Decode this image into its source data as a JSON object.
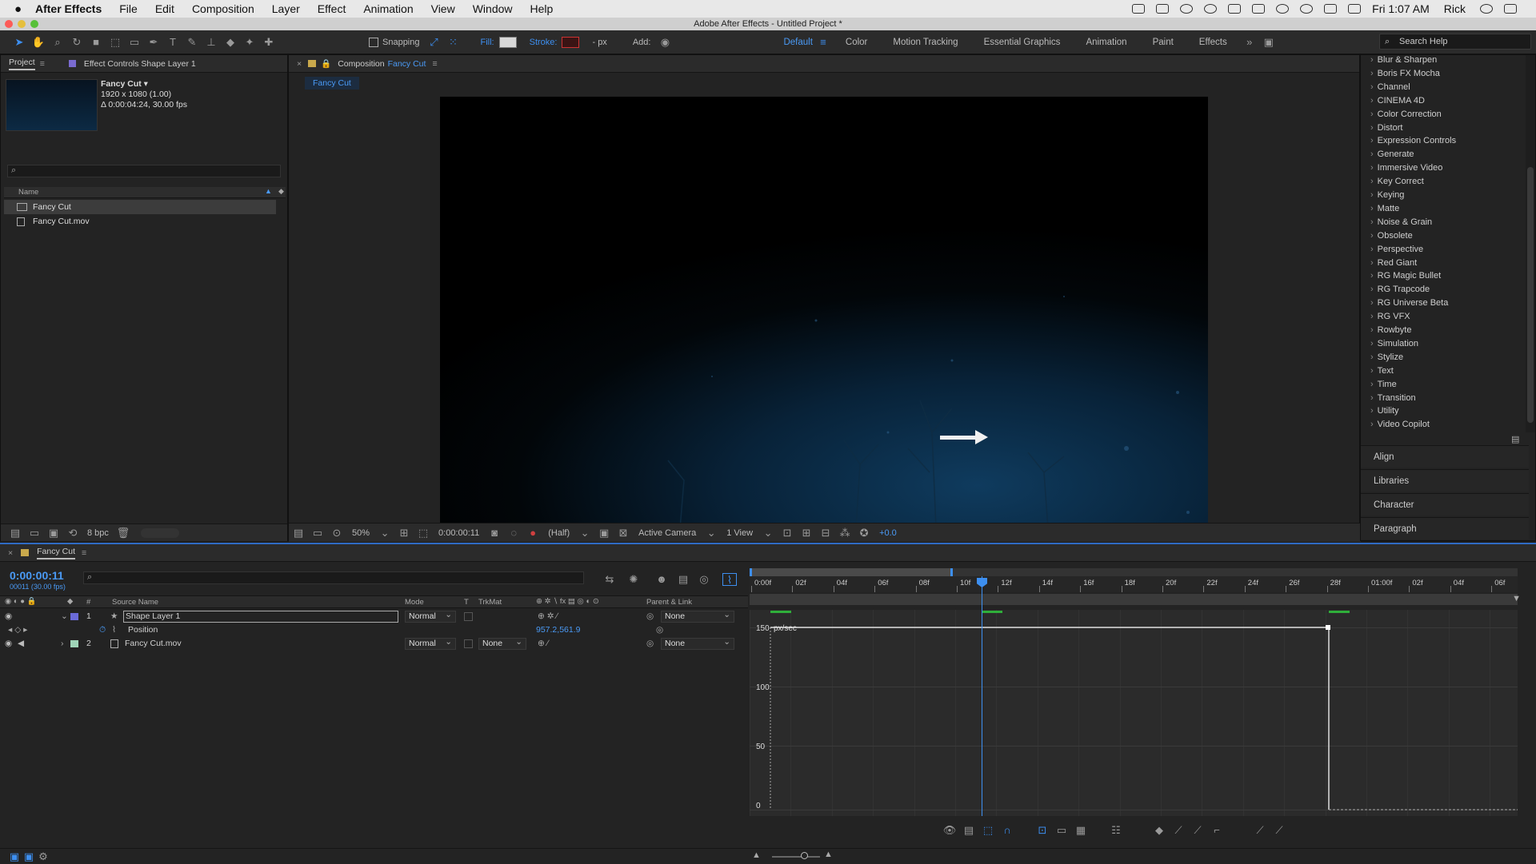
{
  "menubar": {
    "app": "After Effects",
    "items": [
      "File",
      "Edit",
      "Composition",
      "Layer",
      "Effect",
      "Animation",
      "View",
      "Window",
      "Help"
    ],
    "clock": "Fri 1:07 AM",
    "user": "Rick"
  },
  "window": {
    "title": "Adobe After Effects - Untitled Project *"
  },
  "toolbar": {
    "snapping": "Snapping",
    "fill_label": "Fill:",
    "stroke_label": "Stroke:",
    "px_label": "- px",
    "add_label": "Add:",
    "workspaces": [
      "Default",
      "Color",
      "Motion Tracking",
      "Essential Graphics",
      "Animation",
      "Paint",
      "Effects"
    ],
    "search_placeholder": "Search Help"
  },
  "project": {
    "tab": "Project",
    "effect_controls_tab": "Effect Controls Shape Layer 1",
    "selected_name": "Fancy Cut",
    "selected_res": "1920 x 1080 (1.00)",
    "selected_duration": "Δ 0:00:04:24, 30.00 fps",
    "column_name": "Name",
    "items": [
      "Fancy Cut",
      "Fancy Cut.mov"
    ],
    "bpc": "8 bpc"
  },
  "composition": {
    "panel_label": "Composition",
    "name": "Fancy Cut",
    "tab": "Fancy Cut",
    "zoom": "50%",
    "timecode": "0:00:00:11",
    "resolution": "(Half)",
    "camera": "Active Camera",
    "views": "1 View",
    "exposure": "+0.0"
  },
  "effects_list": [
    "Blur & Sharpen",
    "Boris FX Mocha",
    "Channel",
    "CINEMA 4D",
    "Color Correction",
    "Distort",
    "Expression Controls",
    "Generate",
    "Immersive Video",
    "Key Correct",
    "Keying",
    "Matte",
    "Noise & Grain",
    "Obsolete",
    "Perspective",
    "Red Giant",
    "RG Magic Bullet",
    "RG Trapcode",
    "RG Universe Beta",
    "RG VFX",
    "Rowbyte",
    "Simulation",
    "Stylize",
    "Text",
    "Time",
    "Transition",
    "Utility",
    "Video Copilot"
  ],
  "side_sections": [
    "Align",
    "Libraries",
    "Character",
    "Paragraph"
  ],
  "timeline": {
    "tab": "Fancy Cut",
    "timecode": "0:00:00:11",
    "frames": "00011 (30.00 fps)",
    "headers": {
      "source": "Source Name",
      "mode": "Mode",
      "t": "T",
      "trkmat": "TrkMat",
      "parent": "Parent & Link",
      "num": "#"
    },
    "layers": [
      {
        "num": "1",
        "name": "Shape Layer 1",
        "mode": "Normal",
        "trkmat": "",
        "parent": "None"
      },
      {
        "num": "2",
        "name": "Fancy Cut.mov",
        "mode": "Normal",
        "trkmat": "None",
        "parent": "None"
      }
    ],
    "property": {
      "name": "Position",
      "value": "957.2,561.9"
    },
    "ruler": [
      "0:00f",
      "02f",
      "04f",
      "06f",
      "08f",
      "10f",
      "12f",
      "14f",
      "16f",
      "18f",
      "20f",
      "22f",
      "24f",
      "26f",
      "28f",
      "01:00f",
      "02f",
      "04f",
      "06f"
    ],
    "graph_labels": [
      "150",
      "100",
      "50",
      "0"
    ],
    "graph_unit": "px/sec"
  }
}
